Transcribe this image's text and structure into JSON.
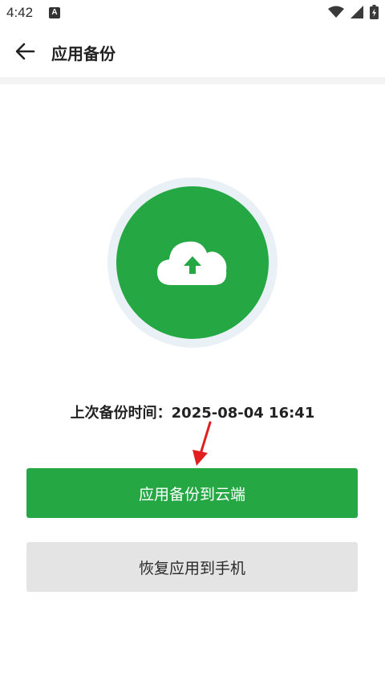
{
  "status_bar": {
    "time": "4:42",
    "notification_letter": "A",
    "icons": [
      "wifi-icon",
      "signal-icon",
      "battery-charging-icon"
    ]
  },
  "app_bar": {
    "title": "应用备份",
    "back_icon": "arrow-left-icon"
  },
  "hero": {
    "icon": "cloud-upload-icon",
    "accent_color": "#25a844",
    "ring_color": "#eaf1f6"
  },
  "backup_info": {
    "label": "上次备份时间：",
    "value": "2025-08-04 16:41"
  },
  "actions": {
    "backup_label": "应用备份到云端",
    "restore_label": "恢复应用到手机"
  },
  "annotation": {
    "arrow_color": "#e02020"
  }
}
